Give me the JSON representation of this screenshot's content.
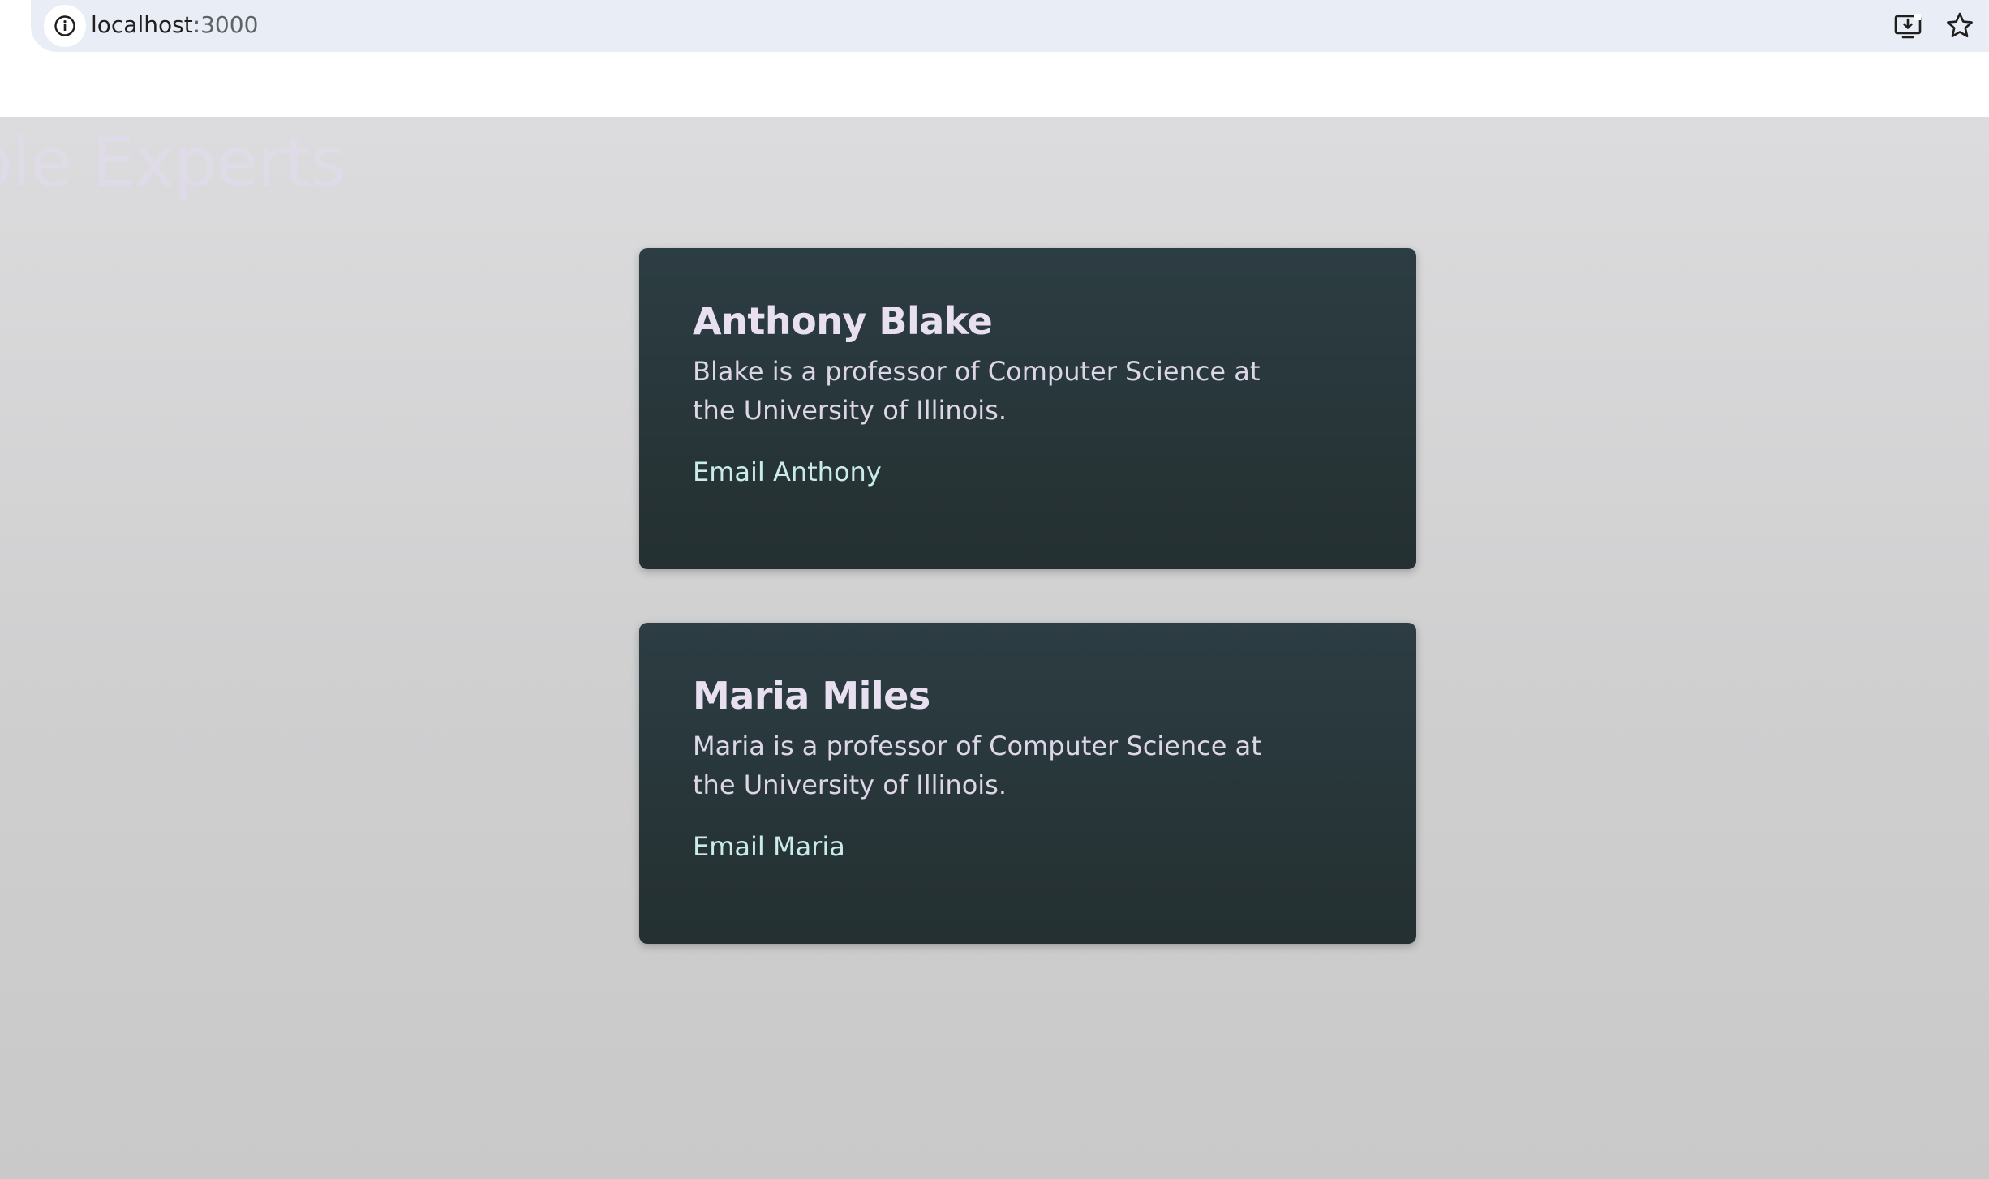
{
  "browser": {
    "url_host": "localhost",
    "url_port": ":3000",
    "icons": {
      "site_info": "info-icon",
      "install": "install-app-icon",
      "bookmark": "star-icon"
    }
  },
  "page": {
    "ghost_heading": "ible Experts",
    "colors": {
      "card_bg": "#2c3d43",
      "name": "#e8e0f0",
      "desc": "#dcd6e6",
      "link": "#c9ecea",
      "page_bg": "#d4d4d5"
    }
  },
  "experts": [
    {
      "name": "Anthony Blake",
      "description": "Blake is a professor of Computer Science at the University of Illinois.",
      "email_label": "Email Anthony"
    },
    {
      "name": "Maria Miles",
      "description": "Maria is a professor of Computer Science at the University of Illinois.",
      "email_label": "Email Maria"
    }
  ]
}
